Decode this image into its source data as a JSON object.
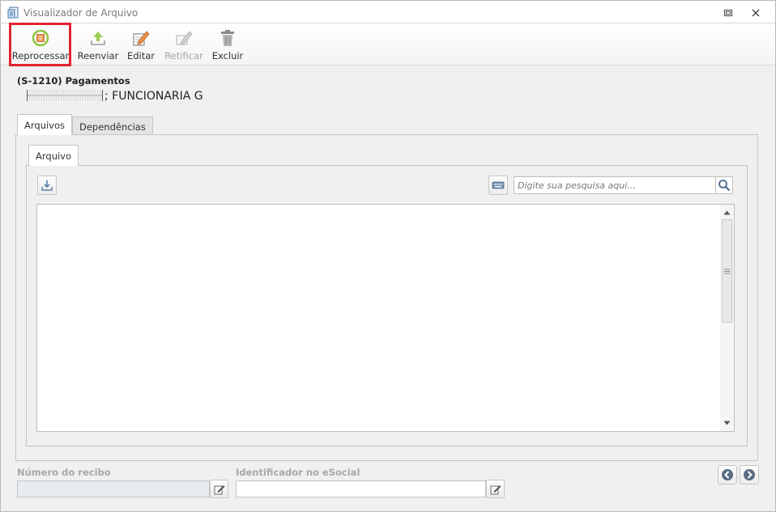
{
  "window": {
    "title": "Visualizador de Arquivo"
  },
  "toolbar": {
    "reprocess_label": "Reprocessar",
    "resend_label": "Reenviar",
    "edit_label": "Editar",
    "rectify_label": "Retificar",
    "delete_label": "Excluir"
  },
  "record": {
    "title": "(S-1210) Pagamentos",
    "subtitle_tail": "; FUNCIONARIA G"
  },
  "tabs": {
    "files": "Arquivos",
    "dependencies": "Dependências",
    "file": "Arquivo"
  },
  "search": {
    "placeholder": "Digite sua pesquisa aqui..."
  },
  "fields": {
    "receipt_label": "Número do recibo",
    "receipt_value": "",
    "esocial_label": "Identificador no eSocial",
    "esocial_value": ""
  },
  "icons": {
    "reprocess": "reprocess-icon",
    "resend": "upload-icon",
    "edit": "pencil-icon",
    "rectify": "pencil-disabled-icon",
    "delete": "trash-icon",
    "download": "download-icon",
    "keyboard": "keyboard-icon",
    "search": "search-icon",
    "prev": "arrow-left-icon",
    "next": "arrow-right-icon"
  },
  "colors": {
    "highlight": "#e0232f",
    "accent_green": "#8cc63f"
  }
}
